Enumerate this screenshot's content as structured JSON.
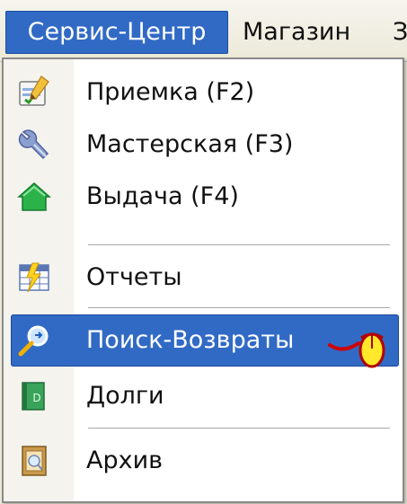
{
  "menubar": {
    "items": [
      {
        "label": "Сервис-Центр",
        "active": true
      },
      {
        "label": "Магазин",
        "active": false
      },
      {
        "label": "З",
        "active": false
      }
    ]
  },
  "dropdown": {
    "items": [
      {
        "label": "Приемка (F2)",
        "icon": "edit-form-icon"
      },
      {
        "label": "Мастерская (F3)",
        "icon": "wrench-icon"
      },
      {
        "label": "Выдача (F4)",
        "icon": "home-icon"
      },
      {
        "label": "Отчеты",
        "icon": "report-icon"
      },
      {
        "label": "Поиск-Возвраты",
        "icon": "search-icon",
        "selected": true
      },
      {
        "label": "Долги",
        "icon": "book-icon"
      },
      {
        "label": "Архив",
        "icon": "archive-icon"
      }
    ]
  },
  "colors": {
    "selection": "#316ac5",
    "menubar_bg": "#ece9d8",
    "menu_bg": "#ffffff",
    "text": "#111111"
  }
}
